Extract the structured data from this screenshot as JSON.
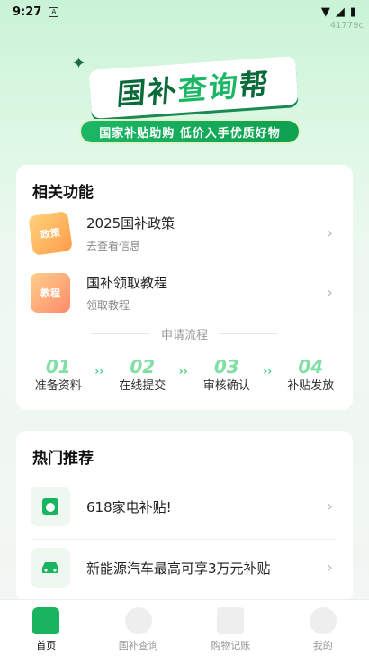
{
  "status_bar": {
    "time": "9:27",
    "sim_label": "A",
    "counter": "41779c"
  },
  "banner": {
    "title_part1": "国补",
    "title_part2": "查询",
    "title_part3": "帮",
    "slogan": "国家补贴助购 低价入手优质好物"
  },
  "features": {
    "title": "相关功能",
    "items": [
      {
        "main": "2025国补政策",
        "sub": "去查看信息",
        "icon_label": "政策"
      },
      {
        "main": "国补领取教程",
        "sub": "领取教程",
        "icon_label": "教程"
      }
    ],
    "process_title": "申请流程",
    "steps": [
      {
        "num": "01",
        "label": "准备资料"
      },
      {
        "num": "02",
        "label": "在线提交"
      },
      {
        "num": "03",
        "label": "审核确认"
      },
      {
        "num": "04",
        "label": "补贴发放"
      }
    ]
  },
  "hot": {
    "title": "热门推荐",
    "items": [
      {
        "main": "618家电补贴!"
      },
      {
        "main": "新能源汽车最高可享3万元补贴"
      }
    ]
  },
  "tabs": [
    {
      "label": "首页"
    },
    {
      "label": "国补查询"
    },
    {
      "label": "购物记账"
    },
    {
      "label": "我的"
    }
  ],
  "colors": {
    "brand": "#19b45f",
    "accent": "#3fd47c"
  }
}
